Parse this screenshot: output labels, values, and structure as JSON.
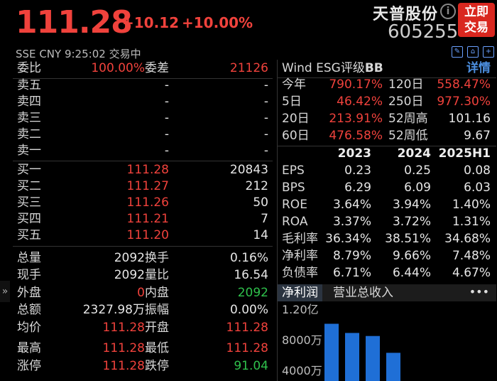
{
  "header": {
    "price": "111.28",
    "change": "+10.12",
    "change_pct": "+10.00%",
    "stock_name": "天普股份",
    "stock_code": "605255",
    "trade_button": [
      "立即",
      "交易"
    ],
    "exchange": "SSE",
    "currency": "CNY",
    "time": "9:25:02",
    "status": "交易中",
    "info_icon": "i"
  },
  "orderbook": {
    "weibi_label": "委比",
    "weibi_value": "100.00%",
    "weicha_label": "委差",
    "weicha_value": "21126",
    "asks": [
      {
        "label": "卖五",
        "price": "-",
        "vol": "-"
      },
      {
        "label": "卖四",
        "price": "-",
        "vol": "-"
      },
      {
        "label": "卖三",
        "price": "-",
        "vol": "-"
      },
      {
        "label": "卖二",
        "price": "-",
        "vol": "-"
      },
      {
        "label": "卖一",
        "price": "-",
        "vol": "-"
      }
    ],
    "bids": [
      {
        "label": "买一",
        "price": "111.28",
        "vol": "20843"
      },
      {
        "label": "买二",
        "price": "111.27",
        "vol": "212"
      },
      {
        "label": "买三",
        "price": "111.26",
        "vol": "50"
      },
      {
        "label": "买四",
        "price": "111.21",
        "vol": "7"
      },
      {
        "label": "买五",
        "price": "111.20",
        "vol": "14"
      }
    ]
  },
  "stats": [
    {
      "l1": "总量",
      "v1": "2092",
      "l2": "换手",
      "v2": "0.16%",
      "c1": "white",
      "c2": "white"
    },
    {
      "l1": "现手",
      "v1": "2092",
      "l2": "量比",
      "v2": "16.54",
      "c1": "white",
      "c2": "white"
    },
    {
      "l1": "外盘",
      "v1": "0",
      "l2": "内盘",
      "v2": "2092",
      "c1": "red",
      "c2": "green"
    },
    {
      "l1": "总额",
      "v1": "2327.98万",
      "l2": "振幅",
      "v2": "0.00%",
      "c1": "white",
      "c2": "white"
    },
    {
      "l1": "均价",
      "v1": "111.28",
      "l2": "开盘",
      "v2": "111.28",
      "c1": "red",
      "c2": "red"
    },
    {
      "l1": "最高",
      "v1": "111.28",
      "l2": "最低",
      "v2": "111.28",
      "c1": "red",
      "c2": "red"
    },
    {
      "l1": "涨停",
      "v1": "111.28",
      "l2": "跌停",
      "v2": "91.04",
      "c1": "red",
      "c2": "green"
    }
  ],
  "right": {
    "esg_label": "Wind ESG评级",
    "esg_rating": "BB",
    "detail_link": "详情",
    "perf": [
      {
        "l1": "今年",
        "v1": "790.17%",
        "l2": "120日",
        "v2": "558.47%",
        "c2": "red"
      },
      {
        "l1": "5日",
        "v1": "46.42%",
        "l2": "250日",
        "v2": "977.30%",
        "c2": "red"
      },
      {
        "l1": "20日",
        "v1": "213.91%",
        "l2": "52周高",
        "v2": "101.16",
        "c2": "white"
      },
      {
        "l1": "60日",
        "v1": "476.58%",
        "l2": "52周低",
        "v2": "9.67",
        "c2": "white"
      }
    ],
    "fin_years": [
      "2023",
      "2024",
      "2025H1"
    ],
    "fin": [
      {
        "k": "EPS",
        "a": "0.23",
        "b": "0.25",
        "c": "0.08"
      },
      {
        "k": "BPS",
        "a": "6.29",
        "b": "6.09",
        "c": "6.03"
      },
      {
        "k": "ROE",
        "a": "3.64%",
        "b": "3.94%",
        "c": "1.40%"
      },
      {
        "k": "ROA",
        "a": "3.37%",
        "b": "3.72%",
        "c": "1.31%"
      },
      {
        "k": "毛利率",
        "a": "36.34%",
        "b": "38.51%",
        "c": "34.68%"
      },
      {
        "k": "净利率",
        "a": "8.79%",
        "b": "9.66%",
        "c": "7.48%"
      },
      {
        "k": "负债率",
        "a": "6.71%",
        "b": "6.44%",
        "c": "4.67%"
      }
    ],
    "tabs": [
      "净利润",
      "营业总收入"
    ],
    "more": "•••"
  },
  "chart_data": {
    "type": "bar",
    "ytick_labels": [
      "1.20亿",
      "8000万",
      "4000万"
    ],
    "yticks": [
      120000000,
      80000000,
      40000000
    ],
    "values": [
      100000000,
      88000000,
      84000000,
      62000000
    ],
    "color": "#1f6fd6"
  },
  "colors": {
    "up": "#f0423c",
    "down": "#2fc14c",
    "accent": "#4c8fe0",
    "trade_button": "#d9271f"
  }
}
